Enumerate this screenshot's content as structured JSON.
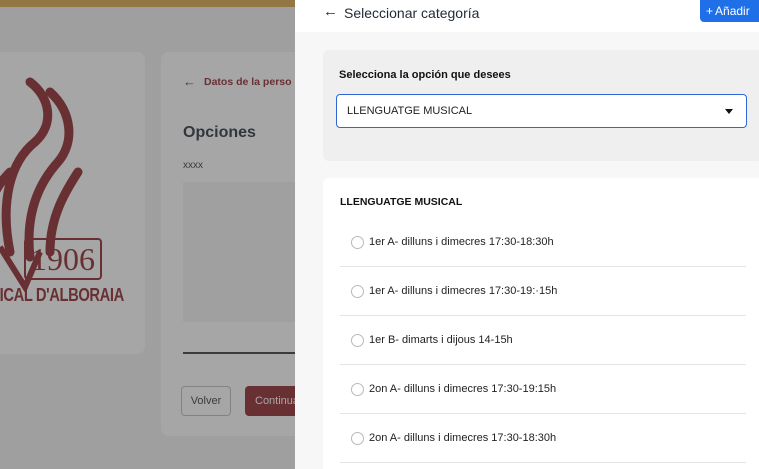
{
  "background": {
    "logo": {
      "year": "1906",
      "text": "USICAL D'ALBORAIA"
    },
    "form": {
      "back_label": "Datos de la perso",
      "title": "Opciones",
      "value": "xxxx",
      "volver_label": "Volver",
      "continue_label": "Continua"
    }
  },
  "drawer": {
    "title": "Seleccionar categoría",
    "add_label": "Añadir",
    "select_label": "Selecciona la opción que desees",
    "selected_value": "LLENGUATGE MUSICAL",
    "list_title": "LLENGUATGE MUSICAL",
    "options": [
      {
        "label": "1er A- dilluns i dimecres 17:30-18:30h"
      },
      {
        "label": "1er A- dilluns i dimecres 17:30-19:·15h"
      },
      {
        "label": "1er B- dimarts i dijous 14-15h"
      },
      {
        "label": "2on A- dilluns i dimecres 17:30-19:15h"
      },
      {
        "label": "2on A- dilluns i dimecres 17:30-18:30h"
      }
    ]
  },
  "colors": {
    "brand": "#8b1d24",
    "primary": "#1e6fe8",
    "focus": "#2f67d8"
  },
  "icons": {
    "back": "arrow-left-icon",
    "add": "plus-icon",
    "dropdown": "caret-down-icon"
  }
}
